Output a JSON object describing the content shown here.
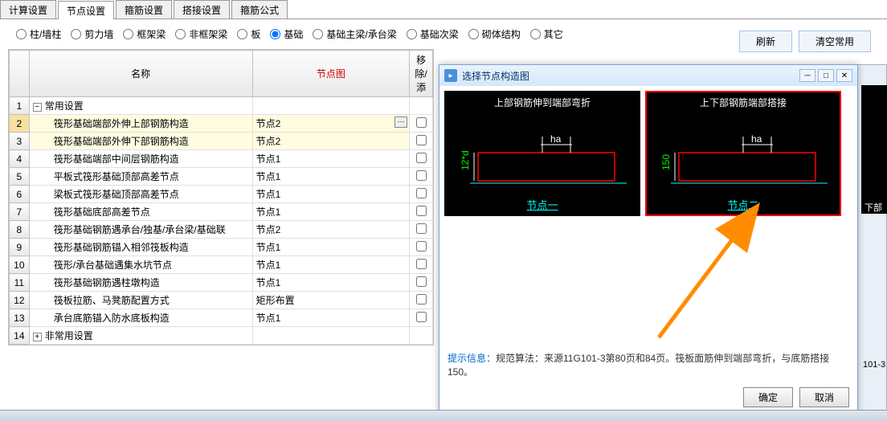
{
  "tabs": [
    "计算设置",
    "节点设置",
    "箍筋设置",
    "搭接设置",
    "箍筋公式"
  ],
  "activeTab": 1,
  "radios": [
    "柱/墙柱",
    "剪力墙",
    "框架梁",
    "非框架梁",
    "板",
    "基础",
    "基础主梁/承台梁",
    "基础次梁",
    "砌体结构",
    "其它"
  ],
  "selectedRadio": 5,
  "buttons": {
    "refresh": "刷新",
    "clear": "清空常用"
  },
  "gridHeaders": {
    "name": "名称",
    "diagram": "节点图",
    "remove": "移除/添"
  },
  "rows": [
    {
      "n": 1,
      "name": "常用设置",
      "diag": "",
      "group": true,
      "open": true
    },
    {
      "n": 2,
      "name": "筏形基础端部外伸上部钢筋构造",
      "diag": "节点2",
      "hl": true,
      "ell": true
    },
    {
      "n": 3,
      "name": "筏形基础端部外伸下部钢筋构造",
      "diag": "节点2",
      "hl": true
    },
    {
      "n": 4,
      "name": "筏形基础端部中间层钢筋构造",
      "diag": "节点1"
    },
    {
      "n": 5,
      "name": "平板式筏形基础顶部高差节点",
      "diag": "节点1"
    },
    {
      "n": 6,
      "name": "梁板式筏形基础顶部高差节点",
      "diag": "节点1"
    },
    {
      "n": 7,
      "name": "筏形基础底部高差节点",
      "diag": "节点1"
    },
    {
      "n": 8,
      "name": "筏形基础钢筋遇承台/独基/承台梁/基础联",
      "diag": "节点2"
    },
    {
      "n": 9,
      "name": "筏形基础钢筋锚入相邻筏板构造",
      "diag": "节点1"
    },
    {
      "n": 10,
      "name": "筏形/承台基础遇集水坑节点",
      "diag": "节点1"
    },
    {
      "n": 11,
      "name": "筏形基础钢筋遇柱墩构造",
      "diag": "节点1"
    },
    {
      "n": 12,
      "name": "筏板拉筋、马凳筋配置方式",
      "diag": "矩形布置"
    },
    {
      "n": 13,
      "name": "承台底筋锚入防水底板构造",
      "diag": "节点1"
    },
    {
      "n": 14,
      "name": "非常用设置",
      "diag": "",
      "group": true,
      "open": false
    }
  ],
  "dialog": {
    "title": "选择节点构造图",
    "thumbs": [
      {
        "title": "上部钢筋伸到端部弯折",
        "caption": "节点一",
        "dim": "12*d",
        "ha": "ha"
      },
      {
        "title": "上下部钢筋端部搭接",
        "caption": "节点二",
        "dim": "150",
        "ha": "ha"
      }
    ],
    "hintLabel": "提示信息：",
    "hintText": "规范算法：来源11G101-3第80页和84页。筏板面筋伸到端部弯折，与底筋搭接150。",
    "ok": "确定",
    "cancel": "取消"
  },
  "bgStrip": "下部",
  "bgPanel": "101-3"
}
